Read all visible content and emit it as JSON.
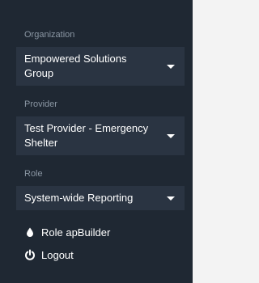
{
  "organization": {
    "label": "Organization",
    "selected": "Empowered Solutions Group"
  },
  "provider": {
    "label": "Provider",
    "selected": "Test Provider - Emergency Shelter"
  },
  "role": {
    "label": "Role",
    "selected": "System-wide Reporting"
  },
  "links": {
    "role_builder": "Role apBuilder",
    "logout": "Logout"
  },
  "icons": {
    "role_builder": "droplet-icon",
    "logout": "power-icon"
  },
  "colors": {
    "panel_bg": "#1f2833",
    "dropdown_bg": "#2a3442",
    "label_text": "#8a96a3",
    "text": "#ffffff",
    "page_bg": "#f3f3f3"
  }
}
